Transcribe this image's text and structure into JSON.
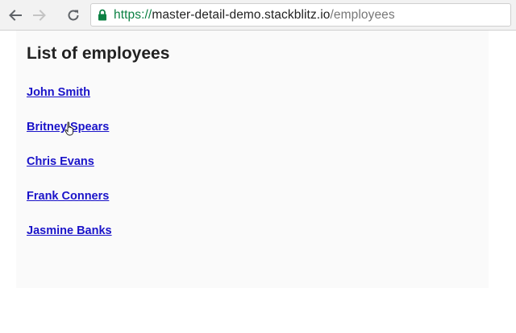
{
  "browser": {
    "url_scheme": "https://",
    "url_host": "master-detail-demo.stackblitz.io",
    "url_path": "/employees",
    "icons": {
      "back": "arrow-left-icon",
      "forward": "arrow-right-icon",
      "reload": "reload-icon",
      "secure": "lock-icon"
    },
    "colors": {
      "secure": "#0b8043"
    }
  },
  "page": {
    "title": "List of employees",
    "employees": [
      {
        "name": "John Smith"
      },
      {
        "name": "Britney Spears"
      },
      {
        "name": "Chris Evans"
      },
      {
        "name": "Frank Conners"
      },
      {
        "name": "Jasmine Banks"
      }
    ],
    "link_color": "#1a13c9"
  }
}
